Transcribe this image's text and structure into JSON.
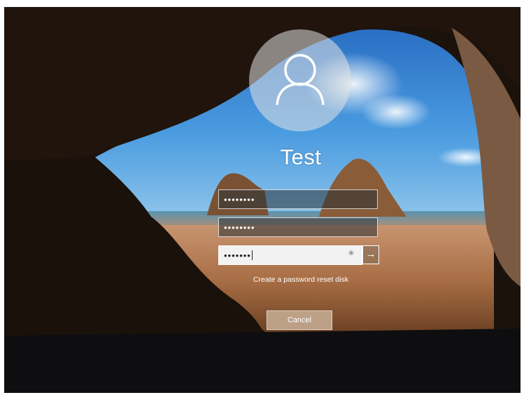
{
  "login": {
    "username": "Test",
    "fields": [
      {
        "role": "old-password",
        "masked_value": "••••••••"
      },
      {
        "role": "new-password",
        "masked_value": "••••••••"
      },
      {
        "role": "confirm-password",
        "masked_value": "•••••••"
      }
    ],
    "submit_icon": "arrow-right-icon",
    "reveal_icon": "eye-icon",
    "reset_link_label": "Create a password reset disk",
    "cancel_label": "Cancel"
  },
  "colors": {
    "sky": "#2f7fd1",
    "sand": "#b07a4f",
    "cave": "#1c120c",
    "avatar_bg": "#d9d9d9"
  }
}
